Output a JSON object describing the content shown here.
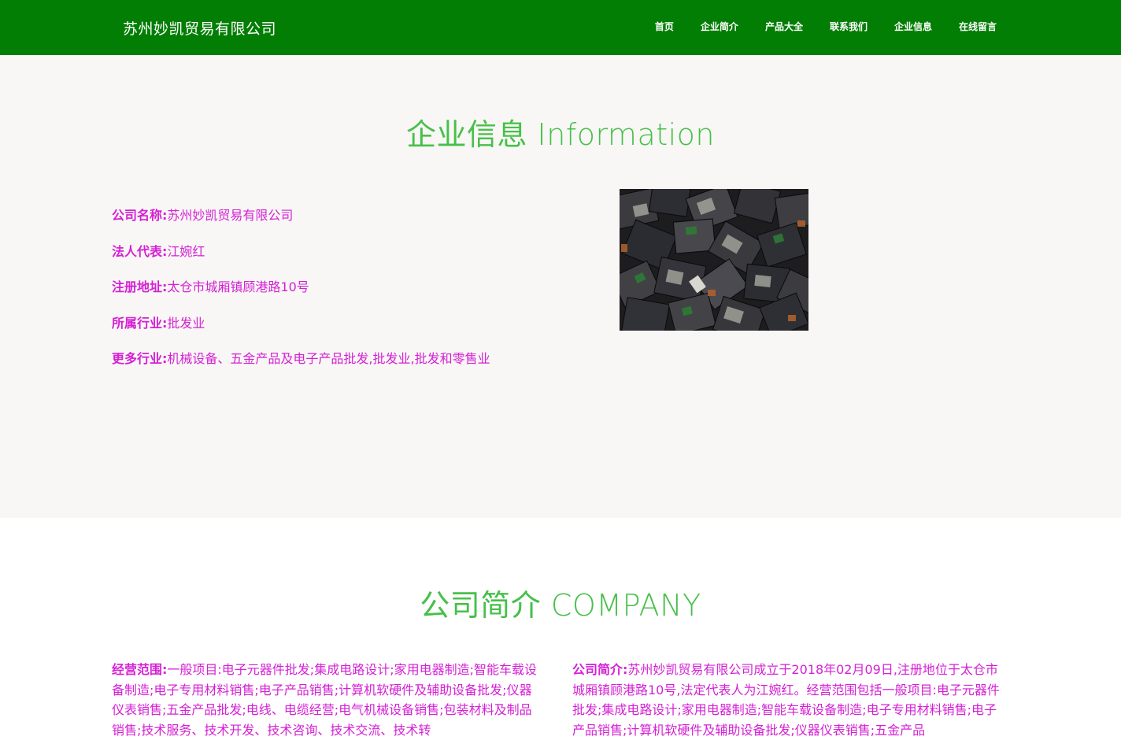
{
  "header": {
    "brand": "苏州妙凯贸易有限公司",
    "nav": [
      "首页",
      "企业简介",
      "产品大全",
      "联系我们",
      "企业信息",
      "在线留言"
    ]
  },
  "info_section": {
    "title": "企业信息 Information",
    "rows": [
      {
        "label": "公司名称:",
        "value": "苏州妙凯贸易有限公司"
      },
      {
        "label": "法人代表:",
        "value": "江婉红"
      },
      {
        "label": "注册地址:",
        "value": "太仓市城厢镇顾港路10号"
      },
      {
        "label": "所属行业:",
        "value": "批发业"
      },
      {
        "label": "更多行业:",
        "value": "机械设备、五金产品及电子产品批发,批发业,批发和零售业"
      }
    ]
  },
  "company_section": {
    "title": "公司简介 COMPANY",
    "scope_label": "经营范围:",
    "scope_text": "一般项目:电子元器件批发;集成电路设计;家用电器制造;智能车载设备制造;电子专用材料销售;电子产品销售;计算机软硬件及辅助设备批发;仪器仪表销售;五金产品批发;电线、电缆经营;电气机械设备销售;包装材料及制品销售;技术服务、技术开发、技术咨询、技术交流、技术转",
    "intro_label": "公司简介:",
    "intro_text": "苏州妙凯贸易有限公司成立于2018年02月09日,注册地位于太仓市城厢镇顾港路10号,法定代表人为江婉红。经营范围包括一般项目:电子元器件批发;集成电路设计;家用电器制造;智能车载设备制造;电子专用材料销售;电子产品销售;计算机软硬件及辅助设备批发;仪器仪表销售;五金产品"
  }
}
